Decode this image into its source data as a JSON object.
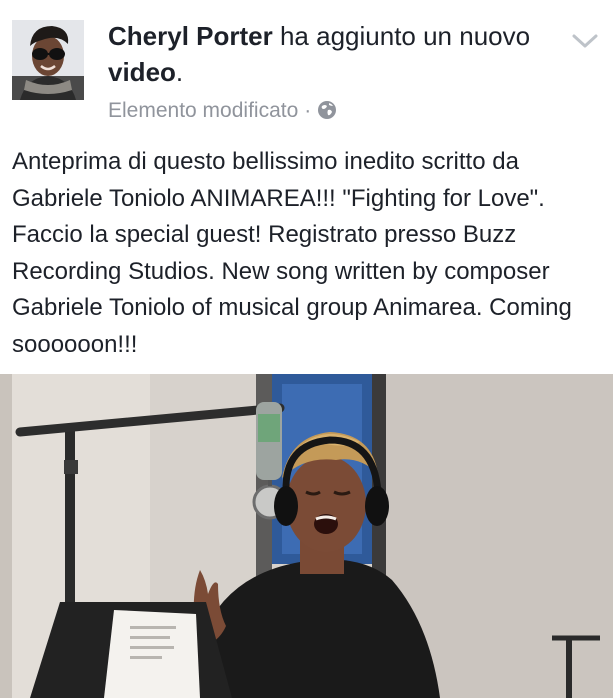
{
  "post": {
    "author": "Cheryl Porter",
    "action": "ha aggiunto un nuovo",
    "object": "video",
    "period": ".",
    "meta": "Elemento modificato",
    "separator": "·",
    "privacy_icon": "globe-icon",
    "menu_icon": "chevron-down-icon",
    "text": "Anteprima di questo bellissimo inedito scritto da Gabriele Toniolo ANIMAREA!!! \"Fighting for Love\". Faccio la special guest! Registrato presso Buzz Recording Studios. New song written by composer Gabriele Toniolo of musical group Animarea. Coming soooooon!!!"
  },
  "colors": {
    "text": "#1d2129",
    "meta": "#90949c",
    "background": "#ffffff"
  }
}
